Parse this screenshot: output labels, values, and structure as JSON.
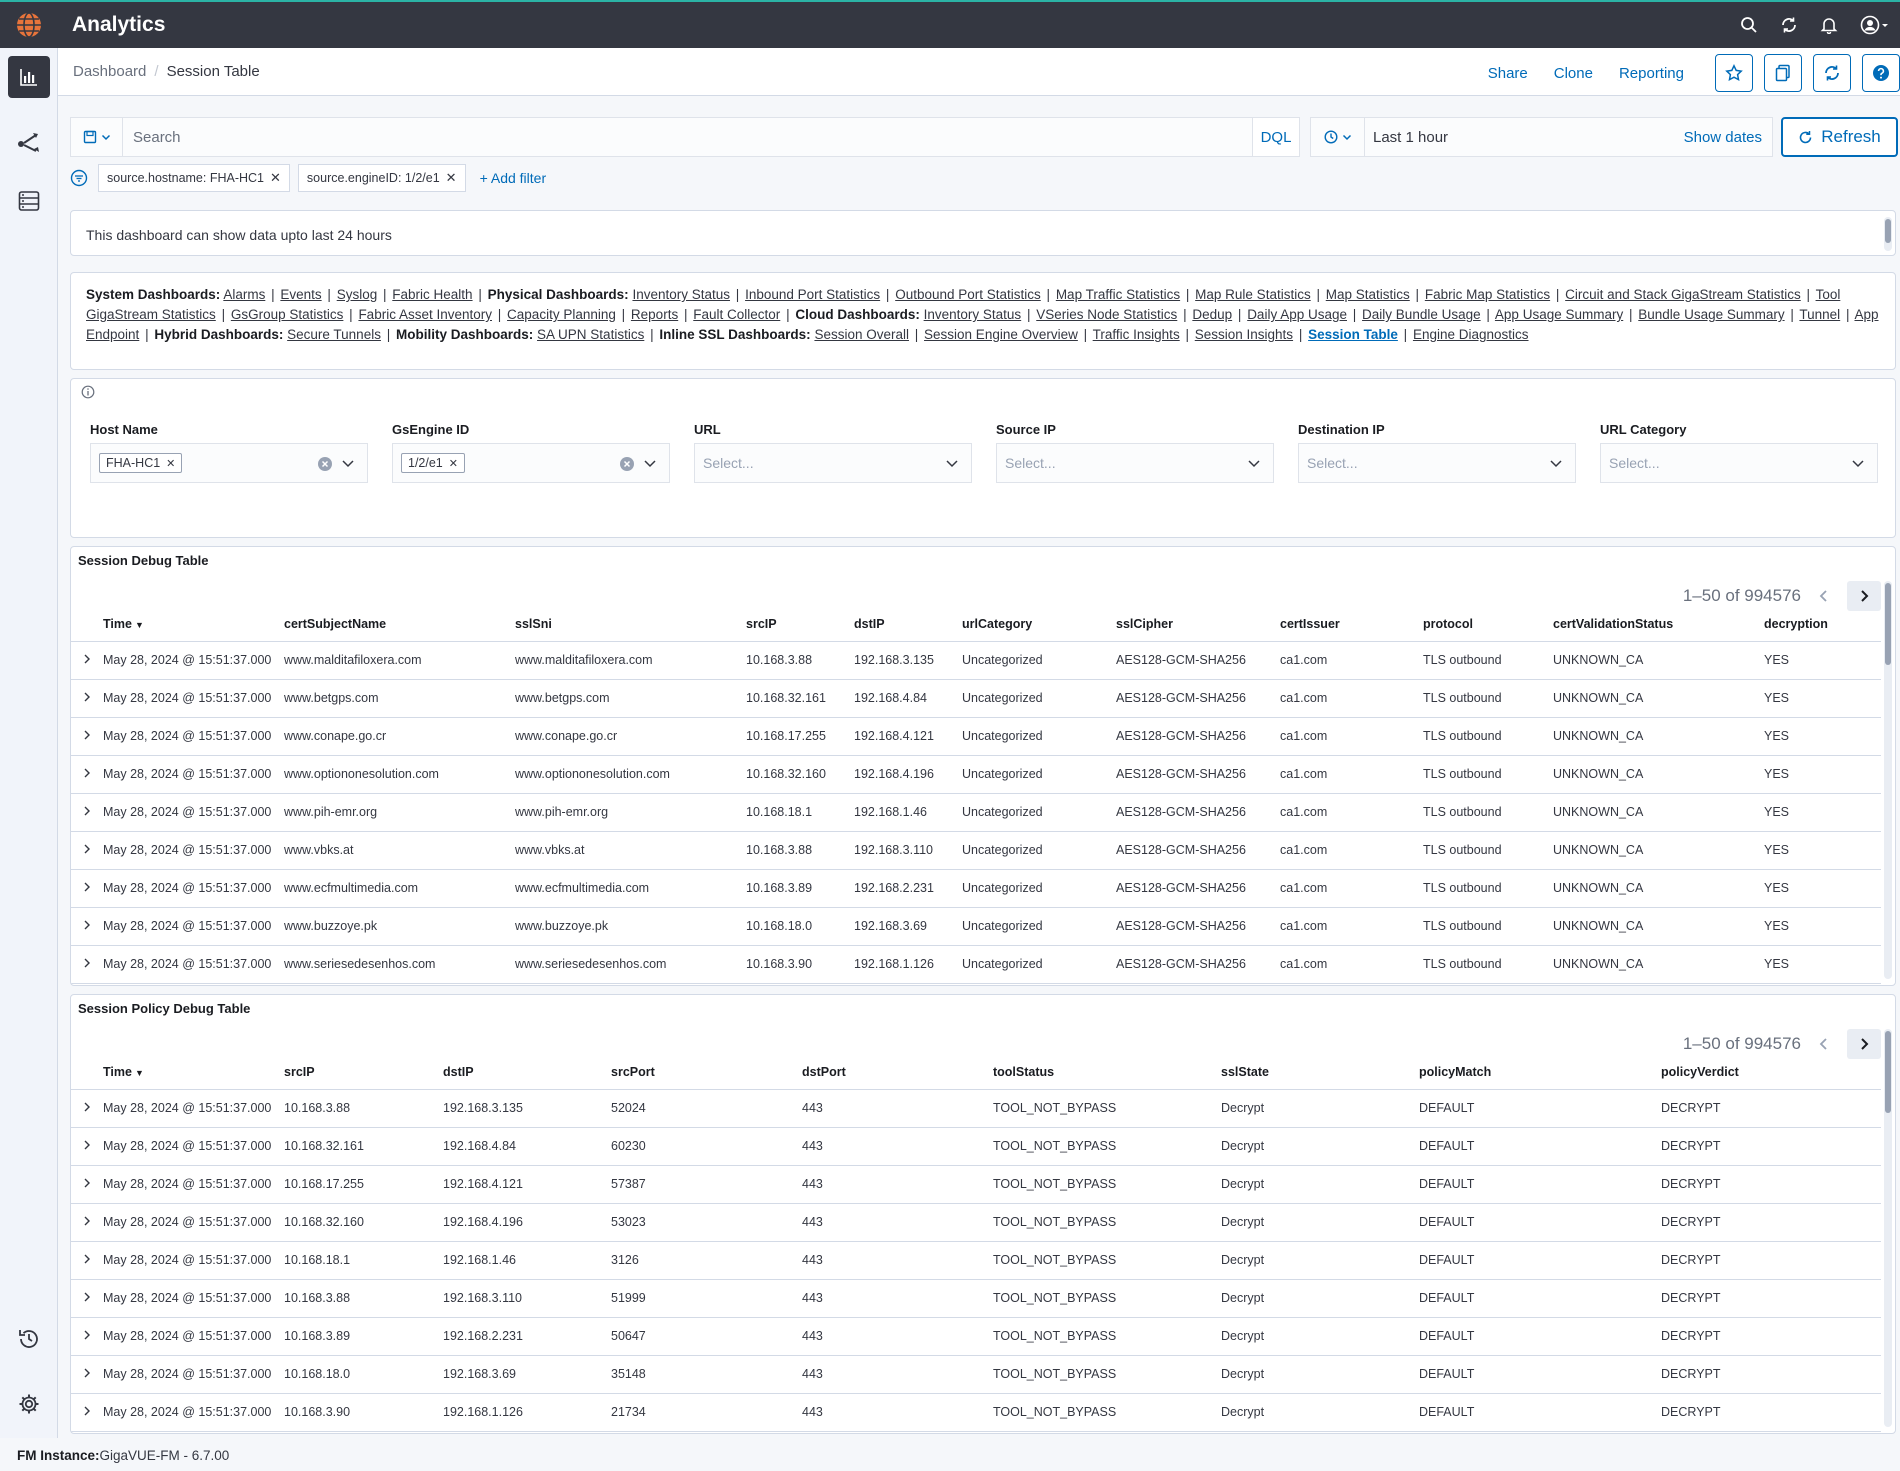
{
  "app": {
    "title": "Analytics"
  },
  "header": {
    "breadcrumbs": [
      "Dashboard",
      "Session Table"
    ],
    "actions": [
      "Share",
      "Clone",
      "Reporting"
    ]
  },
  "query": {
    "search_placeholder": "Search",
    "dql_label": "DQL",
    "time_range": "Last 1 hour",
    "show_dates": "Show dates",
    "refresh_label": "Refresh"
  },
  "filters": {
    "pills": [
      "source.hostname: FHA-HC1",
      "source.engineID: 1/2/e1"
    ],
    "add_label": "+ Add filter"
  },
  "notice": "This dashboard can show data upto last 24 hours",
  "dash_links": [
    {
      "head": "System Dashboards:",
      "items": [
        "Alarms",
        "Events",
        "Syslog",
        "Fabric Health"
      ]
    },
    {
      "head": "Physical Dashboards:",
      "items": [
        "Inventory Status",
        "Inbound Port Statistics",
        "Outbound Port Statistics",
        "Map Traffic Statistics",
        "Map Rule Statistics",
        "Map Statistics",
        "Fabric Map Statistics",
        "Circuit and Stack GigaStream Statistics",
        "Tool GigaStream Statistics",
        "GsGroup Statistics",
        "Fabric Asset Inventory",
        "Capacity Planning",
        "Reports",
        "Fault Collector"
      ]
    },
    {
      "head": "Cloud Dashboards:",
      "items": [
        "Inventory Status",
        "VSeries Node Statistics",
        "Dedup",
        "Daily App Usage",
        "Daily Bundle Usage",
        "App Usage Summary",
        "Bundle Usage Summary",
        "Tunnel",
        "App Endpoint"
      ]
    },
    {
      "head": "Hybrid Dashboards:",
      "items": [
        "Secure Tunnels"
      ]
    },
    {
      "head": "Mobility Dashboards:",
      "items": [
        "SA UPN Statistics"
      ]
    },
    {
      "head": "Inline SSL Dashboards:",
      "items": [
        "Session Overall",
        "Session Engine Overview",
        "Traffic Insights",
        "Session Insights",
        "Session Table",
        "Engine Diagnostics"
      ]
    }
  ],
  "active_link": "Session Table",
  "controls": {
    "host_name": {
      "label": "Host Name",
      "chip": "FHA-HC1"
    },
    "gsengine": {
      "label": "GsEngine ID",
      "chip": "1/2/e1"
    },
    "url": {
      "label": "URL",
      "placeholder": "Select..."
    },
    "source_ip": {
      "label": "Source IP",
      "placeholder": "Select..."
    },
    "dest_ip": {
      "label": "Destination IP",
      "placeholder": "Select..."
    },
    "url_category": {
      "label": "URL Category",
      "placeholder": "Select..."
    }
  },
  "table1": {
    "title": "Session Debug Table",
    "pager": "1–50 of 994576",
    "columns": [
      "Time",
      "certSubjectName",
      "sslSni",
      "srcIP",
      "dstIP",
      "urlCategory",
      "sslCipher",
      "certIssuer",
      "protocol",
      "certValidationStatus",
      "decryption"
    ],
    "rows": [
      [
        "May 28, 2024 @ 15:51:37.000",
        "www.malditafiloxera.com",
        "www.malditafiloxera.com",
        "10.168.3.88",
        "192.168.3.135",
        "Uncategorized",
        "AES128-GCM-SHA256",
        "ca1.com",
        "TLS outbound",
        "UNKNOWN_CA",
        "YES"
      ],
      [
        "May 28, 2024 @ 15:51:37.000",
        "www.betgps.com",
        "www.betgps.com",
        "10.168.32.161",
        "192.168.4.84",
        "Uncategorized",
        "AES128-GCM-SHA256",
        "ca1.com",
        "TLS outbound",
        "UNKNOWN_CA",
        "YES"
      ],
      [
        "May 28, 2024 @ 15:51:37.000",
        "www.conape.go.cr",
        "www.conape.go.cr",
        "10.168.17.255",
        "192.168.4.121",
        "Uncategorized",
        "AES128-GCM-SHA256",
        "ca1.com",
        "TLS outbound",
        "UNKNOWN_CA",
        "YES"
      ],
      [
        "May 28, 2024 @ 15:51:37.000",
        "www.optiononesolution.com",
        "www.optiononesolution.com",
        "10.168.32.160",
        "192.168.4.196",
        "Uncategorized",
        "AES128-GCM-SHA256",
        "ca1.com",
        "TLS outbound",
        "UNKNOWN_CA",
        "YES"
      ],
      [
        "May 28, 2024 @ 15:51:37.000",
        "www.pih-emr.org",
        "www.pih-emr.org",
        "10.168.18.1",
        "192.168.1.46",
        "Uncategorized",
        "AES128-GCM-SHA256",
        "ca1.com",
        "TLS outbound",
        "UNKNOWN_CA",
        "YES"
      ],
      [
        "May 28, 2024 @ 15:51:37.000",
        "www.vbks.at",
        "www.vbks.at",
        "10.168.3.88",
        "192.168.3.110",
        "Uncategorized",
        "AES128-GCM-SHA256",
        "ca1.com",
        "TLS outbound",
        "UNKNOWN_CA",
        "YES"
      ],
      [
        "May 28, 2024 @ 15:51:37.000",
        "www.ecfmultimedia.com",
        "www.ecfmultimedia.com",
        "10.168.3.89",
        "192.168.2.231",
        "Uncategorized",
        "AES128-GCM-SHA256",
        "ca1.com",
        "TLS outbound",
        "UNKNOWN_CA",
        "YES"
      ],
      [
        "May 28, 2024 @ 15:51:37.000",
        "www.buzzoye.pk",
        "www.buzzoye.pk",
        "10.168.18.0",
        "192.168.3.69",
        "Uncategorized",
        "AES128-GCM-SHA256",
        "ca1.com",
        "TLS outbound",
        "UNKNOWN_CA",
        "YES"
      ],
      [
        "May 28, 2024 @ 15:51:37.000",
        "www.seriesedesenhos.com",
        "www.seriesedesenhos.com",
        "10.168.3.90",
        "192.168.1.126",
        "Uncategorized",
        "AES128-GCM-SHA256",
        "ca1.com",
        "TLS outbound",
        "UNKNOWN_CA",
        "YES"
      ]
    ]
  },
  "table2": {
    "title": "Session Policy Debug Table",
    "pager": "1–50 of 994576",
    "columns": [
      "Time",
      "srcIP",
      "dstIP",
      "srcPort",
      "dstPort",
      "toolStatus",
      "sslState",
      "policyMatch",
      "policyVerdict"
    ],
    "rows": [
      [
        "May 28, 2024 @ 15:51:37.000",
        "10.168.3.88",
        "192.168.3.135",
        "52024",
        "443",
        "TOOL_NOT_BYPASS",
        "Decrypt",
        "DEFAULT",
        "DECRYPT"
      ],
      [
        "May 28, 2024 @ 15:51:37.000",
        "10.168.32.161",
        "192.168.4.84",
        "60230",
        "443",
        "TOOL_NOT_BYPASS",
        "Decrypt",
        "DEFAULT",
        "DECRYPT"
      ],
      [
        "May 28, 2024 @ 15:51:37.000",
        "10.168.17.255",
        "192.168.4.121",
        "57387",
        "443",
        "TOOL_NOT_BYPASS",
        "Decrypt",
        "DEFAULT",
        "DECRYPT"
      ],
      [
        "May 28, 2024 @ 15:51:37.000",
        "10.168.32.160",
        "192.168.4.196",
        "53023",
        "443",
        "TOOL_NOT_BYPASS",
        "Decrypt",
        "DEFAULT",
        "DECRYPT"
      ],
      [
        "May 28, 2024 @ 15:51:37.000",
        "10.168.18.1",
        "192.168.1.46",
        "3126",
        "443",
        "TOOL_NOT_BYPASS",
        "Decrypt",
        "DEFAULT",
        "DECRYPT"
      ],
      [
        "May 28, 2024 @ 15:51:37.000",
        "10.168.3.88",
        "192.168.3.110",
        "51999",
        "443",
        "TOOL_NOT_BYPASS",
        "Decrypt",
        "DEFAULT",
        "DECRYPT"
      ],
      [
        "May 28, 2024 @ 15:51:37.000",
        "10.168.3.89",
        "192.168.2.231",
        "50647",
        "443",
        "TOOL_NOT_BYPASS",
        "Decrypt",
        "DEFAULT",
        "DECRYPT"
      ],
      [
        "May 28, 2024 @ 15:51:37.000",
        "10.168.18.0",
        "192.168.3.69",
        "35148",
        "443",
        "TOOL_NOT_BYPASS",
        "Decrypt",
        "DEFAULT",
        "DECRYPT"
      ],
      [
        "May 28, 2024 @ 15:51:37.000",
        "10.168.3.90",
        "192.168.1.126",
        "21734",
        "443",
        "TOOL_NOT_BYPASS",
        "Decrypt",
        "DEFAULT",
        "DECRYPT"
      ]
    ]
  },
  "footer": {
    "label": "FM Instance:",
    "value": "GigaVUE-FM - 6.7.00"
  },
  "colors": {
    "topbar": "#343741",
    "accent": "#006bb8",
    "border": "#d3dae6"
  }
}
